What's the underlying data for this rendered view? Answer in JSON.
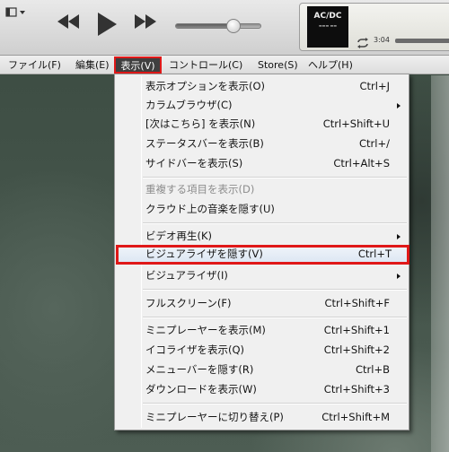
{
  "toolbar": {
    "sidebar_toggle_icon": "sidebar-toggle-icon",
    "prev_icon": "rewind-icon",
    "play_icon": "play-icon",
    "next_icon": "fast-forward-icon",
    "volume_level": 0.68,
    "now_playing": {
      "album_logo": "AC/DC",
      "time_elapsed": "3:04"
    }
  },
  "menubar": {
    "file": "ファイル(F)",
    "edit": "編集(E)",
    "view": "表示(V)",
    "control": "コントロール(C)",
    "store": "Store(S)",
    "help": "ヘルプ(H)"
  },
  "view_menu": {
    "items": [
      {
        "label": "表示オプションを表示(O)",
        "shortcut": "Ctrl+J"
      },
      {
        "label": "カラムブラウザ(C)",
        "shortcut": "",
        "submenu": true
      },
      {
        "label": "[次はこちら] を表示(N)",
        "shortcut": "Ctrl+Shift+U"
      },
      {
        "label": "ステータスバーを表示(B)",
        "shortcut": "Ctrl+/"
      },
      {
        "label": "サイドバーを表示(S)",
        "shortcut": "Ctrl+Alt+S"
      },
      {
        "label": "重複する項目を表示(D)",
        "shortcut": "",
        "disabled": true
      },
      {
        "label": "クラウド上の音楽を隠す(U)",
        "shortcut": ""
      },
      {
        "label": "ビデオ再生(K)",
        "shortcut": "",
        "submenu": true
      },
      {
        "label": "ビジュアライザを隠す(V)",
        "shortcut": "Ctrl+T",
        "highlighted": true
      },
      {
        "label": "ビジュアライザ(I)",
        "shortcut": "",
        "submenu": true
      },
      {
        "label": "フルスクリーン(F)",
        "shortcut": "Ctrl+Shift+F"
      },
      {
        "label": "ミニプレーヤーを表示(M)",
        "shortcut": "Ctrl+Shift+1"
      },
      {
        "label": "イコライザを表示(Q)",
        "shortcut": "Ctrl+Shift+2"
      },
      {
        "label": "メニューバーを隠す(R)",
        "shortcut": "Ctrl+B"
      },
      {
        "label": "ダウンロードを表示(W)",
        "shortcut": "Ctrl+Shift+3"
      },
      {
        "label": "ミニプレーヤーに切り替え(P)",
        "shortcut": "Ctrl+Shift+M"
      }
    ]
  },
  "colors": {
    "highlight_outline": "#e01818",
    "menu_background": "#f0f0f0",
    "active_menu_background": "#3f3f3f"
  }
}
